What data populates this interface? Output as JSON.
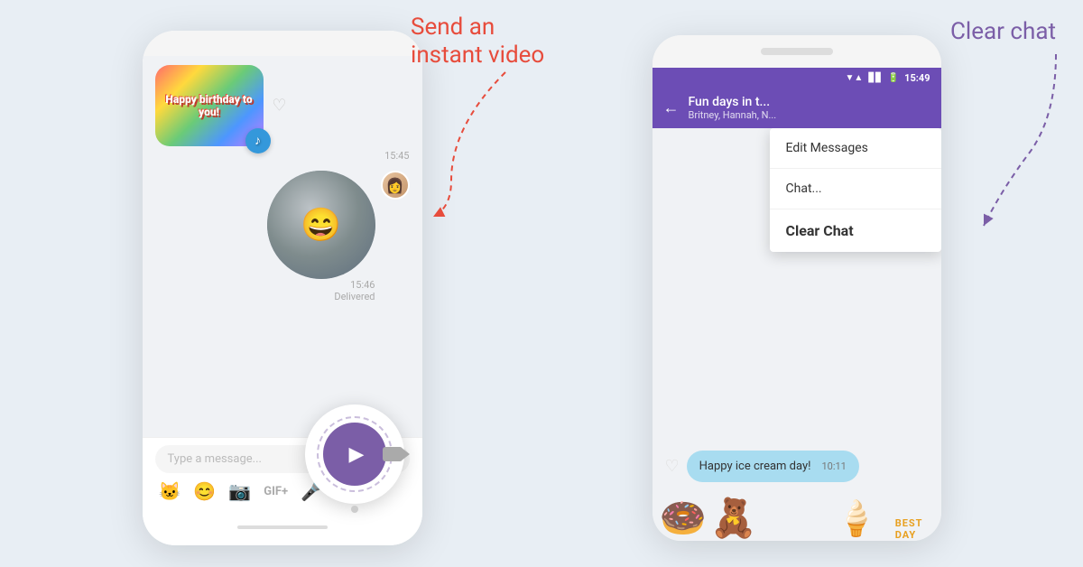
{
  "page": {
    "background": "#e8eef4"
  },
  "left_annotation": {
    "line1": "Send an",
    "line2": "instant video"
  },
  "right_annotation": {
    "line1": "Clear chat"
  },
  "left_phone": {
    "sticker_label": "Happy birthday to you!",
    "msg_time_sticker": "15:45",
    "video_time": "15:46",
    "video_delivered": "Delivered",
    "input_placeholder": "Type a message...",
    "toolbar_icons": [
      "sticker-icon",
      "emoji-icon",
      "camera-icon",
      "gif-icon",
      "mic-icon"
    ]
  },
  "right_phone": {
    "status_time": "15:49",
    "chat_title": "Fun days in t...",
    "chat_subtitle": "Britney, Hannah, N...",
    "menu_items": [
      {
        "label": "Edit Messages",
        "highlighted": false
      },
      {
        "label": "Chat...",
        "highlighted": false
      },
      {
        "label": "Clear Chat",
        "highlighted": true
      }
    ],
    "bubble_text": "Happy ice cream day!",
    "bubble_time": "10:11",
    "inner_time": "10:11"
  }
}
